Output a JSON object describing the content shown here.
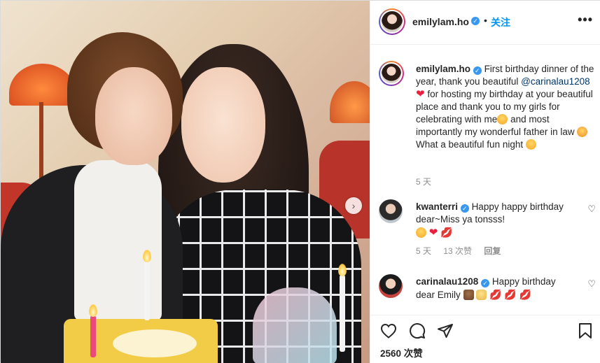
{
  "post": {
    "username": "emilylam.ho",
    "follow_label": "关注",
    "more_label": "•••",
    "separator": "•",
    "caption": {
      "username": "emilylam.ho",
      "text_1": "First birthday dinner of the year, thank you beautiful",
      "mention": "@carinalau1208",
      "text_2": "for hosting my birthday at your beautiful place and thank you to my girls for celebrating with me",
      "text_3": "and most importantly my wonderful father in law",
      "text_4": "What a beautiful fun night",
      "time": "5 天"
    },
    "comments": [
      {
        "username": "kwanterri",
        "text": "Happy happy birthday dear~Miss ya tonsss!",
        "time": "5 天",
        "likes": "13 次赞",
        "reply_label": "回复"
      },
      {
        "username": "carinalau1208",
        "text": "Happy birthday dear Emily"
      }
    ],
    "likes_count": "2560 次赞",
    "icons": {
      "like": "heart-icon",
      "comment": "comment-icon",
      "share": "share-icon",
      "save": "bookmark-icon",
      "verified": "verified-icon",
      "next": "chevron-right-icon"
    },
    "colors": {
      "link": "#0095f6",
      "mention": "#00376b",
      "verified": "#3897f0",
      "heart": "#ed1f3f"
    }
  }
}
